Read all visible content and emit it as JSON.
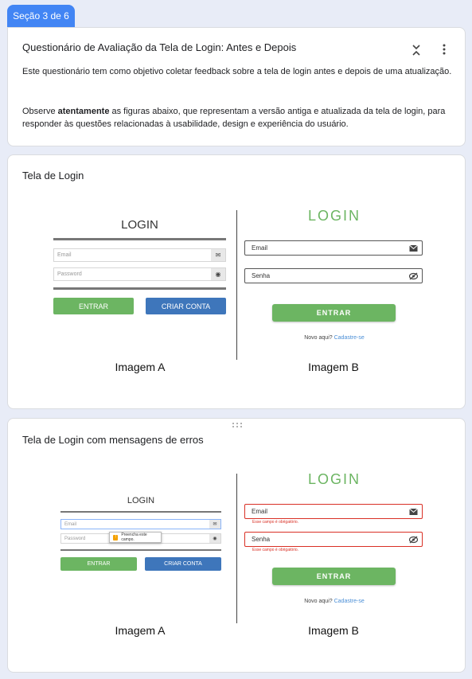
{
  "section": {
    "label": "Seção 3 de 6"
  },
  "header": {
    "title": "Questionário de Avaliação da Tela de Login: Antes e Depois",
    "desc1": "Este questionário tem como objetivo coletar feedback sobre a tela de login antes e depois de uma atualização.",
    "desc2_prefix": "Observe ",
    "desc2_bold": "atentamente",
    "desc2_suffix": " as figuras abaixo, que representam a versão antiga e atualizada da tela de login, para responder às questões relacionadas à usabilidade, design e experiência do usuário."
  },
  "question1": {
    "title": "Tela de Login",
    "imageA": {
      "title": "LOGIN",
      "email_placeholder": "Email",
      "password_placeholder": "Password",
      "btn_entrar": "ENTRAR",
      "btn_criar": "CRIAR CONTA",
      "caption": "Imagem A"
    },
    "imageB": {
      "title": "LOGIN",
      "email_label": "Email",
      "senha_label": "Senha",
      "btn_entrar": "ENTRAR",
      "novo_text": "Novo aqui?",
      "novo_link": "Cadastre-se",
      "caption": "Imagem B"
    }
  },
  "question2": {
    "title": "Tela de Login com mensagens de erros",
    "imageA": {
      "title": "LOGIN",
      "email_placeholder": "Email",
      "password_placeholder": "Password",
      "tooltip": "Preencha este campo.",
      "btn_entrar": "ENTRAR",
      "btn_criar": "CRIAR CONTA",
      "caption": "Imagem A"
    },
    "imageB": {
      "title": "LOGIN",
      "email_label": "Email",
      "email_error": "Esse campo é obrigatório.",
      "senha_label": "Senha",
      "senha_error": "Esse campo é obrigatório.",
      "btn_entrar": "ENTRAR",
      "novo_text": "Novo aqui?",
      "novo_link": "Cadastre-se",
      "caption": "Imagem B"
    }
  },
  "icons": {
    "collapse": "collapse-icon",
    "more": "more-vert-icon",
    "drag": "drag-handle-icon",
    "mail": "mail-icon",
    "eye": "eye-icon",
    "eye_off": "eye-off-icon",
    "warning": "warning-icon"
  },
  "colors": {
    "accent": "#4285f4",
    "green": "#6cb562",
    "blue_button": "#3e76bb",
    "error": "#d93025",
    "link": "#4a8ed6",
    "background": "#e8ecf7"
  }
}
